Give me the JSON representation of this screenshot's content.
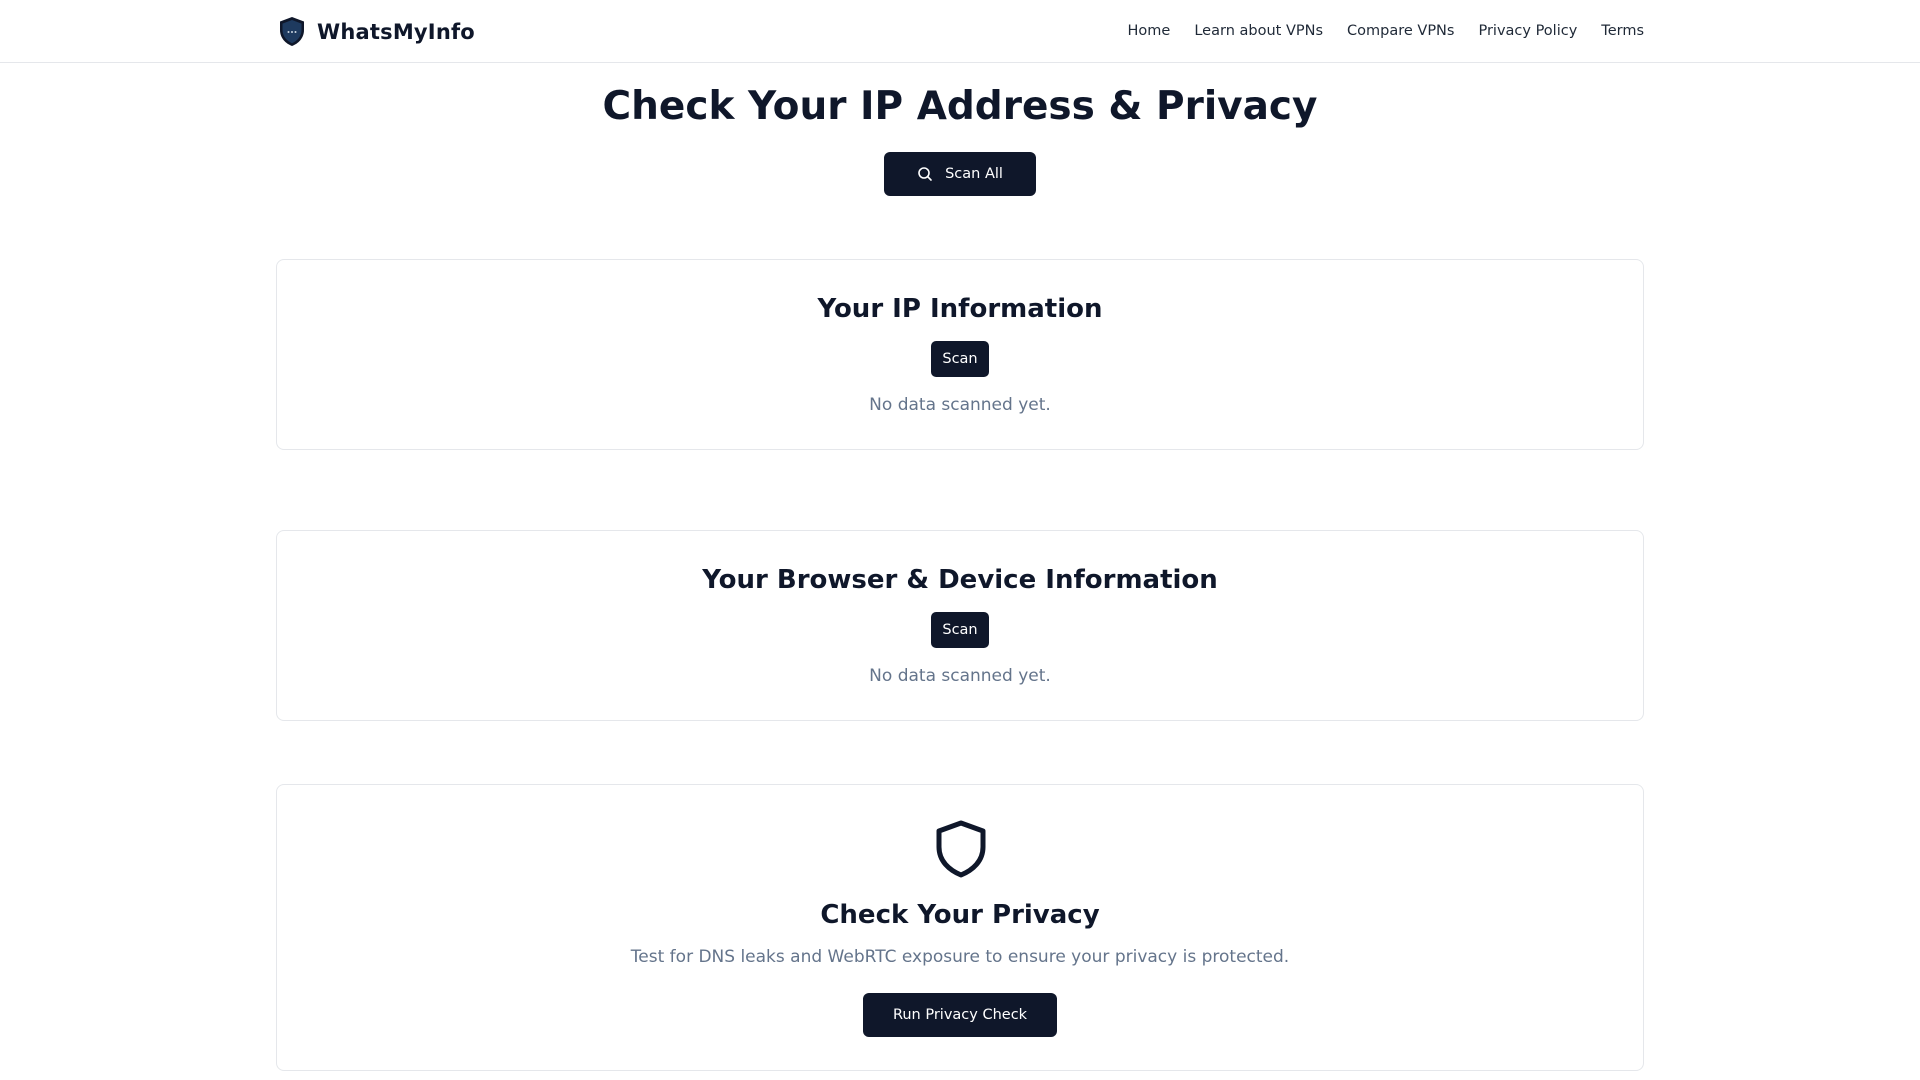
{
  "brand": {
    "name": "WhatsMyInfo",
    "logo_icon": "shield-logo-icon"
  },
  "nav": {
    "items": [
      "Home",
      "Learn about VPNs",
      "Compare VPNs",
      "Privacy Policy",
      "Terms"
    ]
  },
  "hero": {
    "title": "Check Your IP Address & Privacy",
    "scan_all_label": "Scan All",
    "scan_all_icon": "search-icon"
  },
  "ip_section": {
    "title": "Your IP Information",
    "scan_label": "Scan",
    "empty_text": "No data scanned yet."
  },
  "browser_section": {
    "title": "Your Browser & Device Information",
    "scan_label": "Scan",
    "empty_text": "No data scanned yet."
  },
  "privacy_section": {
    "icon": "shield-icon",
    "title": "Check Your Privacy",
    "description": "Test for DNS leaks and WebRTC exposure to ensure your privacy is protected.",
    "button_label": "Run Privacy Check"
  },
  "colors": {
    "primary": "#0f172a",
    "muted_text": "#64748b",
    "border": "#e5e7eb",
    "background": "#ffffff"
  }
}
